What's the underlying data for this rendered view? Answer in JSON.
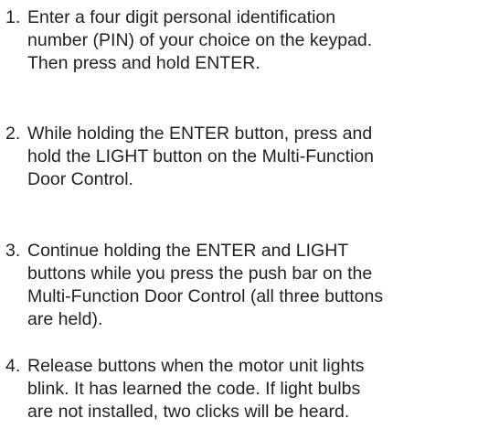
{
  "steps": [
    {
      "number": "1.",
      "text": "Enter a four digit personal identification\nnumber (PIN) of your choice on the keypad.\nThen press and hold ENTER."
    },
    {
      "number": "2.",
      "text": "While holding the ENTER button, press and\nhold the LIGHT button on the Multi-Function\nDoor Control."
    },
    {
      "number": "3.",
      "text": "Continue holding the ENTER and LIGHT\nbuttons while you press the push bar on the\nMulti-Function Door Control (all three buttons\nare held)."
    },
    {
      "number": "4.",
      "text": "Release buttons when the motor unit lights\nblink. It has learned the code. If light bulbs\nare not installed, two clicks will be heard."
    }
  ]
}
